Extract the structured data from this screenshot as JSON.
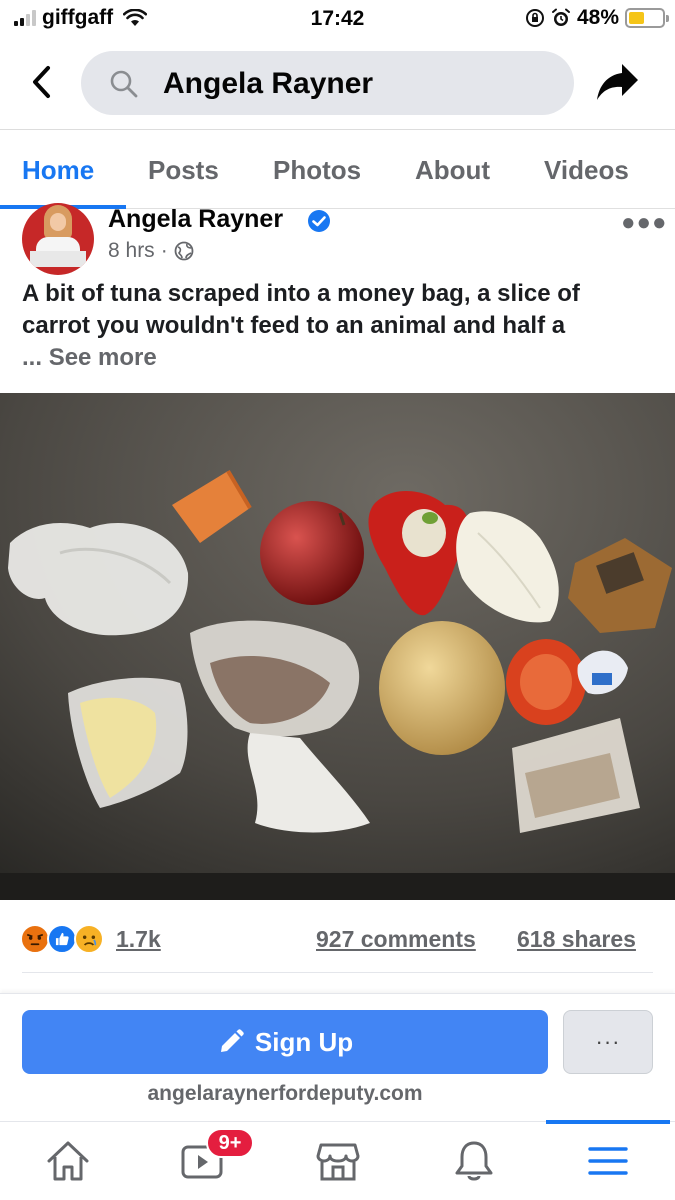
{
  "status_bar": {
    "carrier": "giffgaff",
    "time": "17:42",
    "battery_percent": "48%",
    "battery_level": 0.48,
    "icons": [
      "signal-icon",
      "wifi-icon",
      "orientation-lock-icon",
      "alarm-icon",
      "battery-icon"
    ]
  },
  "search": {
    "query": "Angela Rayner"
  },
  "tabs": [
    {
      "label": "Home",
      "active": true
    },
    {
      "label": "Posts",
      "active": false
    },
    {
      "label": "Photos",
      "active": false
    },
    {
      "label": "About",
      "active": false
    },
    {
      "label": "Videos",
      "active": false
    }
  ],
  "post": {
    "author": "Angela Rayner",
    "verified": true,
    "time": "8 hrs",
    "separator": "·",
    "audience_icon": "globe-icon",
    "text": "A bit of tuna scraped into a money bag, a slice of carrot you wouldn't feed to an animal and half a",
    "ellipsis": "...",
    "see_more": "See more",
    "photo_items": [
      "bag-of-pasta",
      "carrot-slice",
      "apple",
      "red-pepper",
      "half-onion",
      "biscuit-packet",
      "bag-of-cheese",
      "bag-of-tuna",
      "potato",
      "tomato",
      "cheese-portion",
      "bag-of-flour"
    ]
  },
  "engagement": {
    "reaction_icons": [
      "angry-react-icon",
      "like-react-icon",
      "sad-react-icon"
    ],
    "reactions": "1.7k",
    "comments": "927 comments",
    "shares": "618 shares"
  },
  "signup": {
    "button_label": "Sign Up",
    "more_label": "···",
    "url": "angelaraynerfordeputy.com"
  },
  "bottom_nav": {
    "items": [
      "home-icon",
      "watch-icon",
      "marketplace-icon",
      "notifications-icon",
      "menu-icon"
    ],
    "watch_badge": "9+",
    "active": "menu-icon"
  },
  "colors": {
    "accent": "#1877f2",
    "signup_button": "#4285f4",
    "badge": "#e41e3f",
    "battery": "#f5c518"
  }
}
